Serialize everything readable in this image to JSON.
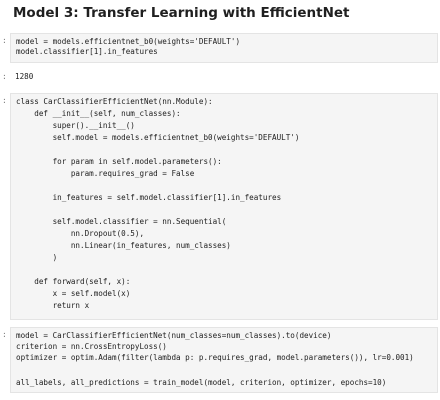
{
  "heading": "Model 3: Transfer Learning with EfficientNet",
  "cells": [
    {
      "prompt": ":",
      "lines": [
        "model = models.efficientnet_b0(weights='DEFAULT')",
        "model.classifier[1].in_features"
      ]
    },
    {
      "prompt": ":",
      "output": "1280"
    },
    {
      "prompt": ":",
      "lines": [
        "class CarClassifierEfficientNet(nn.Module):",
        "    def __init__(self, num_classes):",
        "        super().__init__()",
        "        self.model = models.efficientnet_b0(weights='DEFAULT')",
        "",
        "        for param in self.model.parameters():",
        "            param.requires_grad = False",
        "",
        "        in_features = self.model.classifier[1].in_features",
        "",
        "        self.model.classifier = nn.Sequential(",
        "            nn.Dropout(0.5),",
        "            nn.Linear(in_features, num_classes)",
        "        )",
        "",
        "    def forward(self, x):",
        "        x = self.model(x)",
        "        return x"
      ]
    },
    {
      "prompt": ":",
      "lines": [
        "model = CarClassifierEfficientNet(num_classes=num_classes).to(device)",
        "criterion = nn.CrossEntropyLoss()",
        "optimizer = optim.Adam(filter(lambda p: p.requires_grad, model.parameters()), lr=0.001)",
        "",
        "all_labels, all_predictions = train_model(model, criterion, optimizer, epochs=10)"
      ]
    }
  ]
}
